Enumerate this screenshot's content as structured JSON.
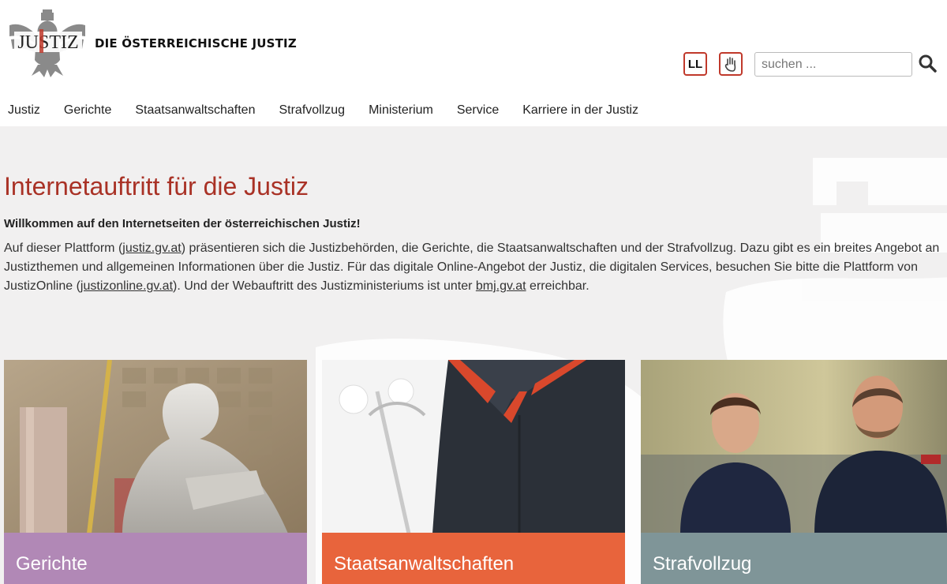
{
  "header": {
    "logo_text": "JUSTIZ",
    "site_title": "DIE ÖSTERREICHISCHE JUSTIZ",
    "easy_language_label": "LL",
    "search": {
      "placeholder": "suchen ..."
    }
  },
  "nav": {
    "items": [
      {
        "label": "Justiz"
      },
      {
        "label": "Gerichte"
      },
      {
        "label": "Staatsanwaltschaften"
      },
      {
        "label": "Strafvollzug"
      },
      {
        "label": "Ministerium"
      },
      {
        "label": "Service"
      },
      {
        "label": "Karriere in der Justiz"
      }
    ]
  },
  "main": {
    "title": "Internetauftritt für die Justiz",
    "intro_heading": "Willkommen auf den Internetseiten der österreichischen Justiz!",
    "intro": {
      "part1": "Auf dieser Plattform (",
      "link1": "justiz.gv.at",
      "part2": ") präsentieren sich die Justizbehörden, die Gerichte, die Staatsanwaltschaften und der Strafvollzug. Dazu gibt es ein breites Angebot an Justizthemen und allgemeinen Informationen über die Justiz. Für das digitale Online-Angebot der Justiz, die digitalen Services, besuchen Sie bitte die Plattform von JustizOnline (",
      "link2": "justizonline.gv.at",
      "part3": "). Und der Webauftritt des Justizministeriums ist unter ",
      "link3": "bmj.gv.at",
      "part4": " erreichbar."
    },
    "cards": [
      {
        "label": "Gerichte",
        "color": "#b188b6",
        "image": "statue-justitia"
      },
      {
        "label": "Staatsanwaltschaften",
        "color": "#e8643c",
        "image": "judicial-robe"
      },
      {
        "label": "Strafvollzug",
        "color": "#7f9598",
        "image": "justizwache-officers"
      }
    ]
  },
  "colors": {
    "accent": "#a93226",
    "background": "#f1f0f0"
  },
  "icons": {
    "search": "search-icon",
    "sign_language": "sign-language-icon"
  }
}
